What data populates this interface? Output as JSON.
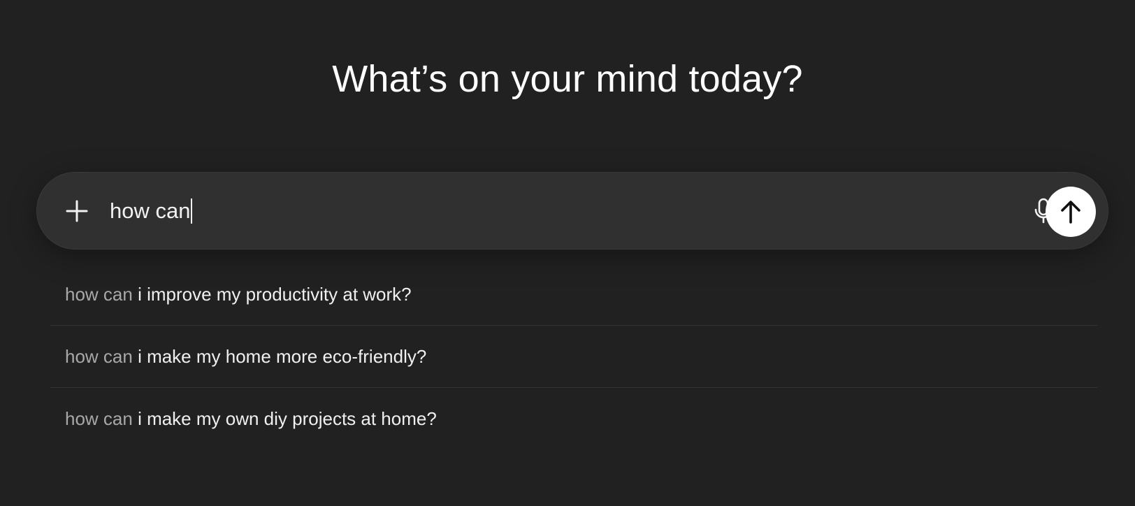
{
  "heading": "What’s on your mind today?",
  "composer": {
    "input_value": "how can",
    "plus_icon": "plus-icon",
    "mic_icon": "microphone-icon",
    "send_icon": "arrow-up-icon"
  },
  "suggestions": [
    {
      "prefix": "how can",
      "rest": " i improve my productivity at work?"
    },
    {
      "prefix": "how can",
      "rest": " i make my home more eco-friendly?"
    },
    {
      "prefix": "how can",
      "rest": " i make my own diy projects at home?"
    }
  ],
  "colors": {
    "background": "#212121",
    "composer": "#303030",
    "send_button": "#ffffff",
    "muted_text": "#a8a8a8"
  }
}
